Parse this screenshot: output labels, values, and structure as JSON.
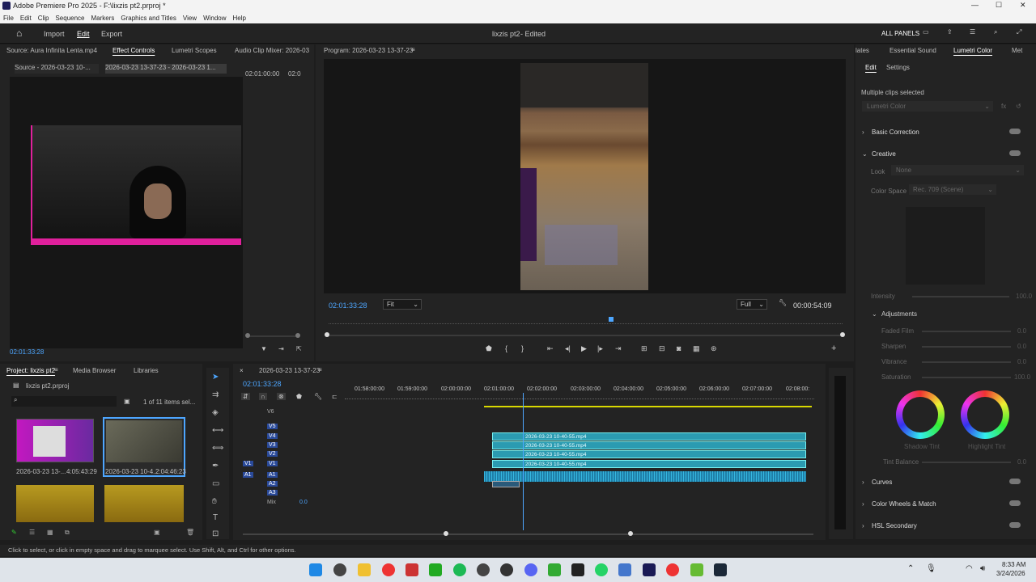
{
  "window": {
    "title": "Adobe Premiere Pro 2025 - F:\\lixzis pt2.prproj *"
  },
  "menu": [
    "File",
    "Edit",
    "Clip",
    "Sequence",
    "Markers",
    "Graphics and Titles",
    "View",
    "Window",
    "Help"
  ],
  "appbar": {
    "import": "Import",
    "edit": "Edit",
    "export": "Export",
    "project_title": "lixzis pt2",
    "edited": "- Edited",
    "all_panels": "ALL PANELS"
  },
  "source": {
    "tabs": [
      "Source: Aura Infinita Lenta.mp4",
      "Effect Controls",
      "Lumetri Scopes",
      "Audio Clip Mixer: 2026-03"
    ],
    "subtab1": "Source - 2026-03-23 10-...",
    "subtab2": "2026-03-23 13-37-23 - 2026-03-23 1...",
    "time_a": "02:01:00:00",
    "time_b": "02:0",
    "timecode": "02:01:33:28"
  },
  "program": {
    "title": "Program: 2026-03-23 13-37-23",
    "timecode": "02:01:33:28",
    "fit": "Fit",
    "full": "Full",
    "duration": "00:00:54:09"
  },
  "lumetri": {
    "tabs": [
      "lates",
      "Essential Sound",
      "Lumetri Color",
      "Met"
    ],
    "subtabs": [
      "Edit",
      "Settings"
    ],
    "multiple": "Multiple clips selected",
    "preset": "Lumetri Color",
    "basic": "Basic Correction",
    "creative": "Creative",
    "look": "Look",
    "look_val": "None",
    "color_space": "Color Space",
    "color_space_val": "Rec. 709 (Scene)",
    "intensity": "Intensity",
    "adjustments": "Adjustments",
    "faded": "Faded Film",
    "sharpen": "Sharpen",
    "vibrance": "Vibrance",
    "saturation": "Saturation",
    "shadow_tint": "Shadow Tint",
    "highlight_tint": "Highlight Tint",
    "tint_balance": "Tint Balance",
    "curves": "Curves",
    "wheels": "Color Wheels & Match",
    "hsl": "HSL Secondary",
    "values": {
      "intensity": "100.0",
      "faded": "0.0",
      "sharpen": "0.0",
      "vibrance": "0.0",
      "saturation": "100.0",
      "tint": "0.0"
    }
  },
  "project": {
    "tabs": [
      "Project: lixzis pt2",
      "Media Browser",
      "Libraries"
    ],
    "file": "lixzis pt2.prproj",
    "count": "1 of 11 items sel...",
    "items": [
      {
        "name": "2026-03-23 13-...",
        "dur": "4:05:43:29"
      },
      {
        "name": "2026-03-23 10-4...",
        "dur": "2:04:46:23"
      }
    ]
  },
  "timeline": {
    "title": "2026-03-23 13-37-23",
    "timecode": "02:01:33:28",
    "ruler": [
      "01:58:00:00",
      "01:59:00:00",
      "02:00:00:00",
      "02:01:00:00",
      "02:02:00:00",
      "02:03:00:00",
      "02:04:00:00",
      "02:05:00:00",
      "02:06:00:00",
      "02:07:00:00",
      "02:08:00:"
    ],
    "tracks_v": [
      "V6",
      "V5",
      "V4",
      "V3",
      "V2",
      "V1"
    ],
    "tracks_a": [
      "A1",
      "A2",
      "A3"
    ],
    "mix": "Mix",
    "mix_val": "0.0",
    "clips": [
      "2026-03-23 10-40-55.mp4",
      "2026-03-23 10-40-55.mp4",
      "2026-03-23 10-40-55.mp4",
      "2026-03-23 10-40-55.mp4"
    ]
  },
  "status": "Click to select, or click in empty space and drag to marquee select. Use Shift, Alt, and Ctrl for other options.",
  "clock": {
    "time": "8:33 AM",
    "date": "3/24/2026"
  }
}
